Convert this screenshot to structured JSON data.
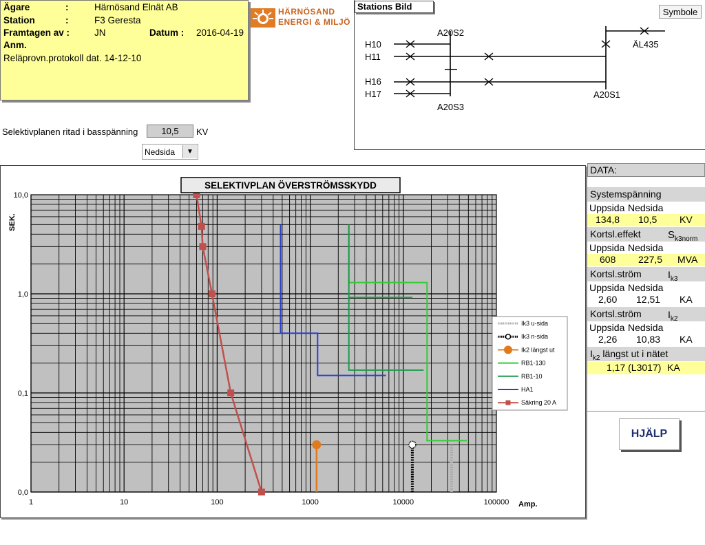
{
  "info": {
    "agare_label": "Ägare",
    "agare_value": "Härnösand Elnät AB",
    "station_label": "Station",
    "station_value": "F3 Geresta",
    "framtagen_label": "Framtagen av :",
    "framtagen_value": "JN",
    "datum_label": "Datum :",
    "datum_value": "2016-04-19",
    "anm_label": "Anm.",
    "note": "Reläprovn.protokoll dat. 14-12-10",
    "colon": ":"
  },
  "logo": {
    "line1": "HÄRNÖSAND",
    "line2": "ENERGI & MILJÖ",
    "color": "#c8641e"
  },
  "station_image": {
    "title": "Stations Bild",
    "symbol_button": "Symbole",
    "labels": {
      "a20s2": "A20S2",
      "h10": "H10",
      "h11": "H11",
      "h16": "H16",
      "h17": "H17",
      "a20s3": "A20S3",
      "a20s1": "A20S1",
      "al435": "ÄL435"
    }
  },
  "plan": {
    "label": "Selektivplanen ritad i basspänning",
    "value": "10,5",
    "unit": "KV",
    "select_value": "Nedsida"
  },
  "data_panel": {
    "title": "DATA:",
    "systemspanning": {
      "label": "Systemspänning",
      "col1": "Uppsida",
      "col2": "Nedsida",
      "v1": "134,8",
      "v2": "10,5",
      "unit": "KV"
    },
    "kortsl_effekt": {
      "label": "Kortsl.effekt",
      "symbol": "S",
      "sub": "k3norm",
      "col1": "Uppsida",
      "col2": "Nedsida",
      "v1": "608",
      "v2": "227,5",
      "unit": "MVA"
    },
    "kortsl_strom3": {
      "label": "Kortsl.ström",
      "symbol": "I",
      "sub": "k3",
      "col1": "Uppsida",
      "col2": "Nedsida",
      "v1": "2,60",
      "v2": "12,51",
      "unit": "KA"
    },
    "kortsl_strom2": {
      "label": "Kortsl.ström",
      "symbol": "I",
      "sub": "k2",
      "col1": "Uppsida",
      "col2": "Nedsida",
      "v1": "2,26",
      "v2": "10,83",
      "unit": "KA"
    },
    "ik2_langst": {
      "symbol": "I",
      "sub": "k2",
      "label": " längst ut i nätet",
      "value": "1,17 (L3017)",
      "unit": "KA"
    }
  },
  "help_button": "HJÄLP",
  "chart_data": {
    "type": "line",
    "title": "SELEKTIVPLAN ÖVERSTRÖMSSKYDD",
    "ylabel": "SEK.",
    "xlabel": "Amp.",
    "x_scale": "log",
    "y_scale": "log",
    "xlim": [
      1,
      100000
    ],
    "ylim": [
      0.01,
      10
    ],
    "x_ticks": [
      "1",
      "10",
      "100",
      "1000",
      "10000",
      "100000"
    ],
    "y_ticks": [
      "10,0",
      "1,0",
      "0,1",
      "0,0"
    ],
    "grid": true,
    "legend_position": "right",
    "series": [
      {
        "name": "Ik3 u-sida",
        "color": "#aaaaaa",
        "style": "hatched-stem",
        "x": [
          [
            33000,
            33000
          ]
        ],
        "y": [
          [
            0.01,
            0.03
          ]
        ]
      },
      {
        "name": "Ik3 n-sida",
        "color": "#000000",
        "style": "hatched-stem",
        "x": [
          [
            12500,
            12500
          ]
        ],
        "y": [
          [
            0.01,
            0.03
          ]
        ]
      },
      {
        "name": "Ik2 längst ut",
        "color": "#e07a1e",
        "style": "stem",
        "x": [
          [
            1170,
            1170
          ]
        ],
        "y": [
          [
            0.01,
            0.03
          ]
        ]
      },
      {
        "name": "RB1-130",
        "color": "#33cc33",
        "style": "step",
        "x": [
          2600,
          2600,
          18000,
          18000,
          48000
        ],
        "y": [
          5,
          1.3,
          1.3,
          0.033,
          0.033
        ]
      },
      {
        "name": "RB1-10",
        "color": "#1a9a4a",
        "style": "step",
        "x": [
          [
            2600,
            2600,
            16500
          ],
          [
            2600,
            12500
          ]
        ],
        "y": [
          [
            5,
            0.17,
            0.17
          ],
          [
            0.92,
            0.92
          ]
        ]
      },
      {
        "name": "HA1",
        "color": "#2a3fcc",
        "style": "step",
        "x": [
          480,
          480,
          1200,
          1200,
          6500
        ],
        "y": [
          5,
          0.4,
          0.4,
          0.15,
          0.15
        ]
      },
      {
        "name": "Säkring 20 A",
        "color": "#c0504d",
        "style": "line-marker",
        "x": [
          60,
          68,
          70,
          88,
          140,
          300
        ],
        "y": [
          10,
          4.8,
          3.0,
          1.0,
          0.1,
          0.01
        ]
      }
    ]
  }
}
